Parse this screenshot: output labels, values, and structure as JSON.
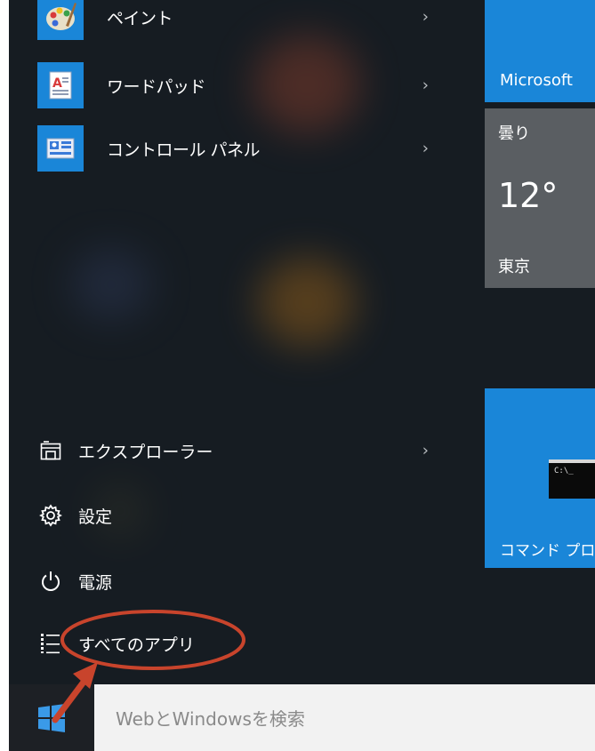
{
  "apps": [
    {
      "label": "ペイント",
      "icon": "paint-palette-icon",
      "chevron": "›"
    },
    {
      "label": "ワードパッド",
      "icon": "wordpad-icon",
      "chevron": "›"
    },
    {
      "label": "コントロール パネル",
      "icon": "control-panel-icon",
      "chevron": "›"
    }
  ],
  "system_menu": {
    "explorer": {
      "label": "エクスプローラー",
      "icon": "file-explorer-icon",
      "chevron": "›"
    },
    "settings": {
      "label": "設定",
      "icon": "gear-icon"
    },
    "power": {
      "label": "電源",
      "icon": "power-icon"
    },
    "all_apps": {
      "label": "すべてのアプリ",
      "icon": "list-icon"
    }
  },
  "tiles": {
    "microsoft": {
      "label": "Microsoft"
    },
    "weather": {
      "condition": "曇り",
      "temperature": "12°",
      "city": "東京"
    },
    "command_prompt": {
      "label": "コマンド プロ",
      "window_text": "C:\\_"
    }
  },
  "taskbar": {
    "start_icon": "windows-logo-icon",
    "search_placeholder": "WebとWindowsを検索"
  },
  "colors": {
    "menu_background": "#161c22",
    "tile_accent": "#1a86d8",
    "weather_tile": "#5a5e62",
    "annotation": "#c8442c"
  }
}
